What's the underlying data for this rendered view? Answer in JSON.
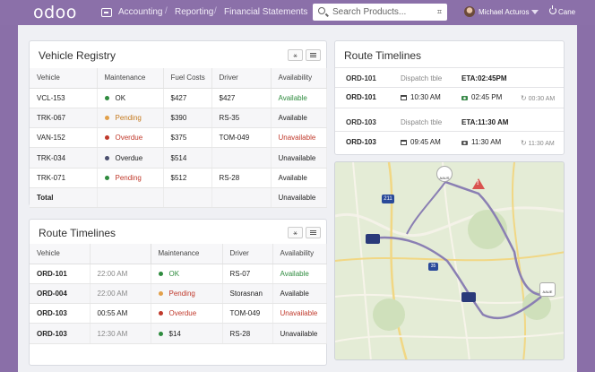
{
  "app": {
    "logo": "odoo",
    "nav": [
      "Accounting",
      "Reporting",
      "Financial Statements"
    ],
    "search": {
      "placeholder": "Search Products..."
    },
    "user": "Michael Acturos",
    "logout": "Cane"
  },
  "vehicle_registry": {
    "title": "Vehicle Registry",
    "columns": [
      "Vehicle",
      "Maintenance",
      "Fuel Costs",
      "Driver",
      "Availability"
    ],
    "rows": [
      {
        "vehicle": "VCL-153",
        "maintenance": "OK",
        "fuel": "$427",
        "driver": "$427",
        "availability": "Available"
      },
      {
        "vehicle": "TRK-067",
        "maintenance": "Pending",
        "fuel": "$390",
        "driver": "RS-35",
        "availability": "Available"
      },
      {
        "vehicle": "VAN-152",
        "maintenance": "Overdue",
        "fuel": "$375",
        "driver": "TOM-049",
        "availability": "Unavailable"
      },
      {
        "vehicle": "TRK-034",
        "maintenance": "Overdue",
        "fuel": "$514",
        "driver": "",
        "availability": "Unavailable"
      },
      {
        "vehicle": "TRK-071",
        "maintenance": "Pending",
        "fuel": "$512",
        "driver": "RS-28",
        "availability": "Available"
      },
      {
        "vehicle": "Total",
        "maintenance": "",
        "fuel": "",
        "driver": "",
        "availability": "Unavailable"
      }
    ]
  },
  "route_timelines_table": {
    "title": "Route Timelines",
    "columns": [
      "Vehicle",
      "Maintenance",
      "Driver",
      "Availability"
    ],
    "rows": [
      {
        "vehicle": "ORD-101",
        "time": "22:00 AM",
        "maintenance": "OK",
        "driver": "RS-07",
        "availability": "Available"
      },
      {
        "vehicle": "ORD-004",
        "time": "22:00 AM",
        "maintenance": "Pending",
        "driver": "Storasnan",
        "availability": "Available"
      },
      {
        "vehicle": "ORD-103",
        "time": "00:55 AM",
        "maintenance": "Overdue",
        "driver": "TOM-049",
        "availability": "Unavailable"
      },
      {
        "vehicle": "ORD-103",
        "time": "12:30 AM",
        "maintenance": "$14",
        "driver": "RS-28",
        "availability": "Unavailable"
      }
    ]
  },
  "route_timelines_panel": {
    "title": "Route Timelines",
    "groups": [
      {
        "order": "ORD-101",
        "dispatch": "Dispatch tble",
        "eta": "ETA:02:45PM",
        "order2": "ORD-101",
        "depart": "10:30 AM",
        "arrive": "02:45 PM",
        "elapsed": "00:30 AM"
      },
      {
        "order": "ORD-103",
        "dispatch": "Dispatch tble",
        "eta": "ETA:11:30 AM",
        "order2": "ORD-103",
        "depart": "09:45 AM",
        "arrive": "11:30 AM",
        "elapsed": "11:30 AM"
      }
    ]
  },
  "map": {
    "markers": [
      {
        "label": "AAUS"
      },
      {
        "label": "AAUE"
      }
    ],
    "highway_labels": [
      "211",
      "35"
    ]
  },
  "colors": {
    "brand": "#8b70a9",
    "ok": "#2e8b3e",
    "pending": "#e2a04a",
    "overdue": "#c0392b",
    "route": "#8a7fb3",
    "van": "#2a3a7a"
  }
}
